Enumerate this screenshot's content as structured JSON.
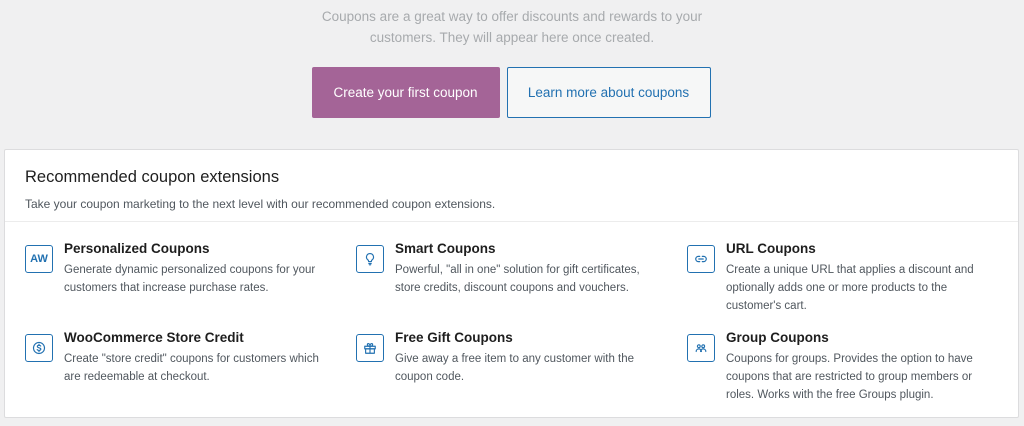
{
  "intro": {
    "line1": "Coupons are a great way to offer discounts and rewards to your",
    "line2": "customers. They will appear here once created."
  },
  "actions": {
    "primary_label": "Create your first coupon",
    "secondary_label": "Learn more about coupons"
  },
  "recommended": {
    "title": "Recommended coupon extensions",
    "subtitle": "Take your coupon marketing to the next level with our recommended coupon extensions.",
    "items": [
      {
        "icon": "aw-icon",
        "icon_text": "AW",
        "name": "Personalized Coupons",
        "desc_lines": [
          "Generate dynamic personalized coupons for your",
          "customers that increase purchase rates."
        ]
      },
      {
        "icon": "lightbulb-icon",
        "name": "Smart Coupons",
        "desc_lines": [
          "Powerful, \"all in one\" solution for gift certificates,",
          "store credits, discount coupons and vouchers."
        ]
      },
      {
        "icon": "link-icon",
        "name": "URL Coupons",
        "desc_lines": [
          "Create a unique URL that applies a discount and",
          "optionally adds one or more products to the",
          "customer's cart."
        ]
      },
      {
        "icon": "dollar-icon",
        "name": "WooCommerce Store Credit",
        "desc_lines": [
          "Create \"store credit\" coupons for customers which",
          "are redeemable at checkout."
        ]
      },
      {
        "icon": "gift-icon",
        "name": "Free Gift Coupons",
        "desc_lines": [
          "Give away a free item to any customer with the",
          "coupon code."
        ]
      },
      {
        "icon": "group-icon",
        "name": "Group Coupons",
        "desc_lines": [
          "Coupons for groups. Provides the option to have",
          "coupons that are restricted to group members or",
          "roles. Works with the free Groups plugin."
        ]
      }
    ]
  },
  "colors": {
    "primary": "#a46497",
    "accent": "#2271b1",
    "background": "#f0f0f1"
  }
}
